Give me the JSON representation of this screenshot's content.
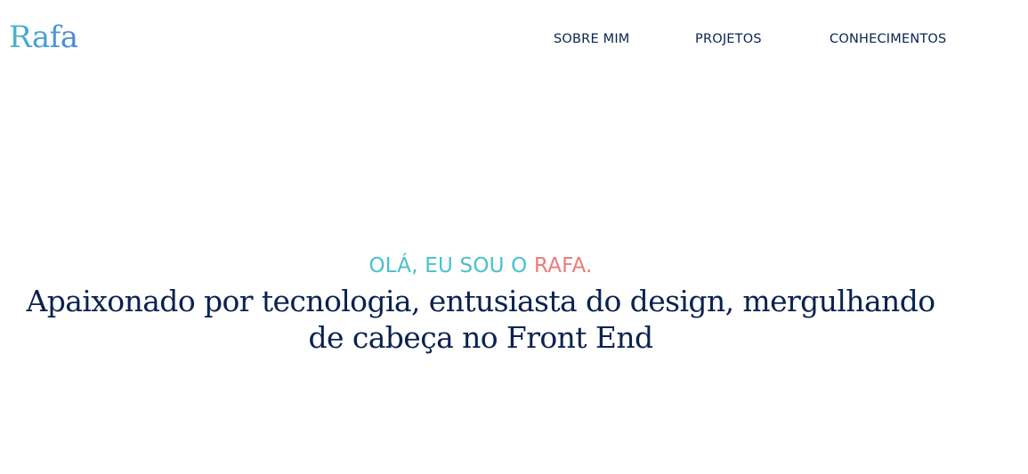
{
  "header": {
    "logo_text": "Rafa",
    "nav": {
      "sobre_mim": "SOBRE MIM",
      "projetos": "PROJETOS",
      "conhecimentos": "CONHECIMENTOS"
    }
  },
  "hero": {
    "greeting_prefix": "OLÁ, EU SOU O ",
    "greeting_name": "RAFA.",
    "headline": "Apaixonado por tecnologia, entusiasta do design, mergulhando de cabeça no Front End"
  },
  "colors": {
    "logo_gradient_start": "#45b6cd",
    "logo_gradient_end": "#4a86dc",
    "nav_text": "#0b2250",
    "greeting_teal": "#4ac1c9",
    "greeting_name_coral": "#ec7a7a",
    "headline_text": "#0b2250",
    "background": "#ffffff"
  }
}
